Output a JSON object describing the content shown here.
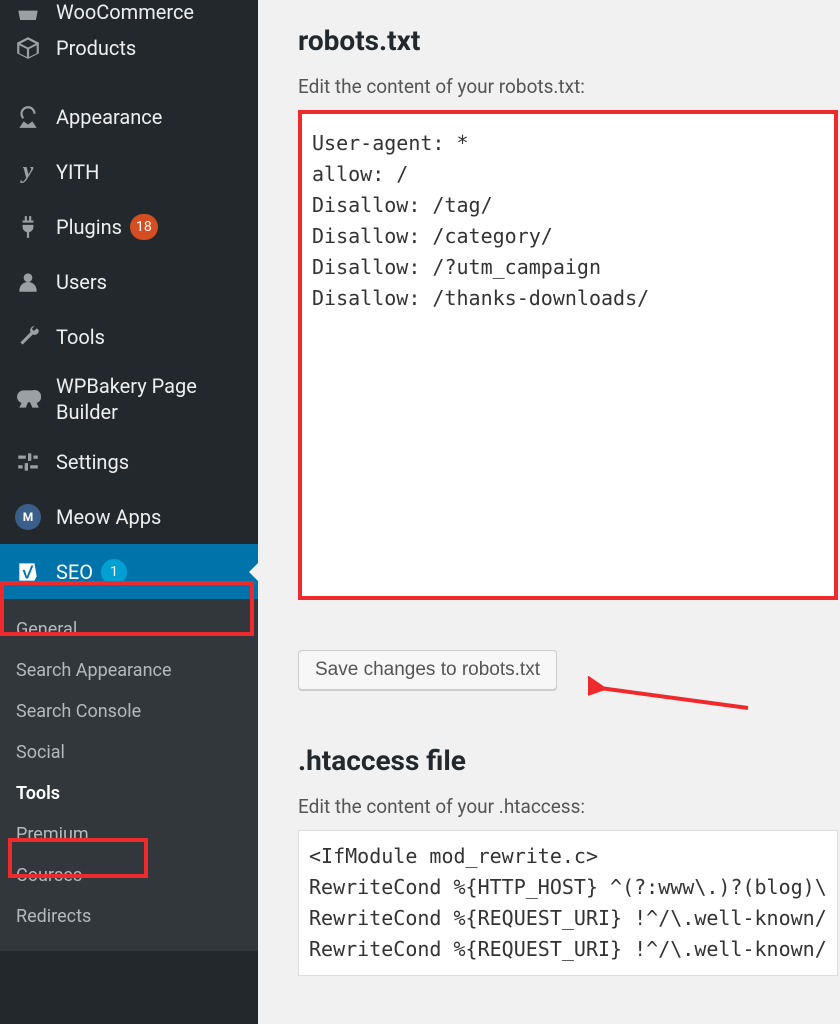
{
  "sidebar": {
    "items": [
      {
        "label": "WooCommerce"
      },
      {
        "label": "Products"
      },
      {
        "label": "Appearance"
      },
      {
        "label": "YITH"
      },
      {
        "label": "Plugins",
        "badge": "18"
      },
      {
        "label": "Users"
      },
      {
        "label": "Tools"
      },
      {
        "label": "WPBakery Page Builder"
      },
      {
        "label": "Settings"
      },
      {
        "label": "Meow Apps"
      },
      {
        "label": "SEO",
        "badge": "1"
      }
    ],
    "submenu": [
      {
        "label": "General"
      },
      {
        "label": "Search Appearance"
      },
      {
        "label": "Search Console"
      },
      {
        "label": "Social"
      },
      {
        "label": "Tools"
      },
      {
        "label": "Premium"
      },
      {
        "label": "Courses"
      },
      {
        "label": "Redirects"
      }
    ]
  },
  "robots": {
    "heading": "robots.txt",
    "desc": "Edit the content of your robots.txt:",
    "content": "User-agent: *\nallow: /\nDisallow: /tag/\nDisallow: /category/\nDisallow: /?utm_campaign\nDisallow: /thanks-downloads/",
    "save_label": "Save changes to robots.txt"
  },
  "htaccess": {
    "heading": ".htaccess file",
    "desc": "Edit the content of your .htaccess:",
    "content": "<IfModule mod_rewrite.c>\nRewriteCond %{HTTP_HOST} ^(?:www\\.)?(blog)\\\nRewriteCond %{REQUEST_URI} !^/\\.well-known/\nRewriteCond %{REQUEST_URI} !^/\\.well-known/"
  }
}
